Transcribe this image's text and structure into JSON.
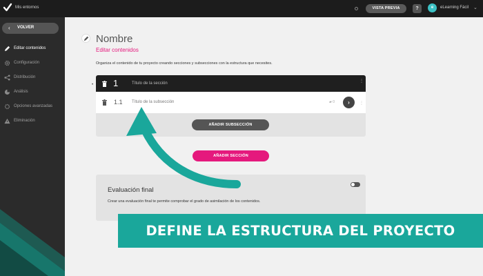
{
  "topbar": {
    "environment": "Mis entornos",
    "preview_label": "VISTA PREVIA",
    "help_label": "?",
    "avatar_initials": "e",
    "user_name": "eLearning Fácil"
  },
  "sidebar": {
    "back_label": "VOLVER",
    "items": [
      {
        "label": "Editar contenidos",
        "icon": "pencil-icon",
        "active": true
      },
      {
        "label": "Configuración",
        "icon": "gear-icon",
        "active": false
      },
      {
        "label": "Distribución",
        "icon": "share-icon",
        "active": false
      },
      {
        "label": "Análisis",
        "icon": "pie-chart-icon",
        "active": false
      },
      {
        "label": "Opciones avanzadas",
        "icon": "gears-icon",
        "active": false
      },
      {
        "label": "Eliminación",
        "icon": "warning-icon",
        "active": false
      }
    ]
  },
  "main": {
    "project_name": "Nombre",
    "section_subtitle": "Editar contenidos",
    "description": "Organiza el contenido de tu proyecto creando secciones y subsecciones con la estructura que necesites.",
    "section": {
      "number": "1",
      "title": "Título de la sección"
    },
    "subsection": {
      "number": "1.1",
      "title": "Título de la subsección",
      "count": "0"
    },
    "add_subsection_label": "AÑADIR SUBSECCIÓN",
    "add_section_label": "AÑADIR SECCIÓN",
    "final_eval": {
      "title": "Evaluación final",
      "description": "Crear una evaluación final te permite comprobar el grado de asimilación de los contenidos."
    }
  },
  "banner": {
    "text": "DEFINE LA ESTRUCTURA DEL PROYECTO"
  },
  "colors": {
    "accent_pink": "#e5197d",
    "teal": "#1aa79b",
    "sidebar_bg": "#2b2b2b",
    "topbar_bg": "#1c1c1c"
  }
}
